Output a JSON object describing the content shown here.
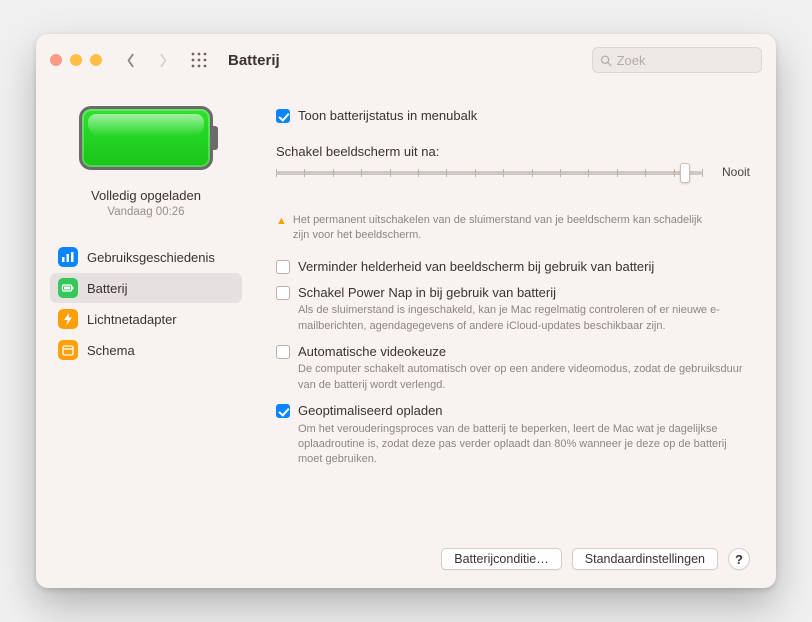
{
  "toolbar": {
    "title": "Batterij",
    "search_placeholder": "Zoek"
  },
  "sidebar": {
    "status_title": "Volledig opgeladen",
    "status_subtitle": "Vandaag 00:26",
    "items": [
      {
        "id": "usage-history",
        "label": "Gebruiksgeschiedenis",
        "icon": "bars-icon",
        "color": "ic-blue"
      },
      {
        "id": "battery",
        "label": "Batterij",
        "icon": "battery-icon",
        "color": "ic-green"
      },
      {
        "id": "power-adapter",
        "label": "Lichtnetadapter",
        "icon": "bolt-icon",
        "color": "ic-orange"
      },
      {
        "id": "schedule",
        "label": "Schema",
        "icon": "calendar-icon",
        "color": "ic-orange"
      }
    ],
    "selected": "battery"
  },
  "content": {
    "show_in_menubar": {
      "checked": true,
      "label": "Toon batterijstatus in menubalk"
    },
    "display_off_label": "Schakel beeldscherm uit na:",
    "slider": {
      "value_position_pct": 96,
      "right_label": "Nooit"
    },
    "slider_warning": "Het permanent uitschakelen van de sluimerstand van je beeldscherm kan schadelijk zijn voor het beeldscherm.",
    "dim_on_battery": {
      "checked": false,
      "label": "Verminder helderheid van beeldscherm bij gebruik van batterij"
    },
    "power_nap": {
      "checked": false,
      "label": "Schakel Power Nap in bij gebruik van batterij",
      "desc": "Als de sluimerstand is ingeschakeld, kan je Mac regelmatig controleren of er nieuwe e-mailberichten, agendagegevens of andere iCloud-updates beschikbaar zijn."
    },
    "auto_video": {
      "checked": false,
      "label": "Automatische videokeuze",
      "desc": "De computer schakelt automatisch over op een andere videomodus, zodat de gebruiksduur van de batterij wordt verlengd."
    },
    "optimized_charging": {
      "checked": true,
      "label": "Geoptimaliseerd opladen",
      "desc": "Om het verouderingsproces van de batterij te beperken, leert de Mac wat je dagelijkse oplaadroutine is, zodat deze pas verder oplaadt dan 80% wanneer je deze op de batterij moet gebruiken."
    }
  },
  "footer": {
    "battery_condition": "Batterijconditie…",
    "defaults": "Standaardinstellingen",
    "help": "?"
  }
}
